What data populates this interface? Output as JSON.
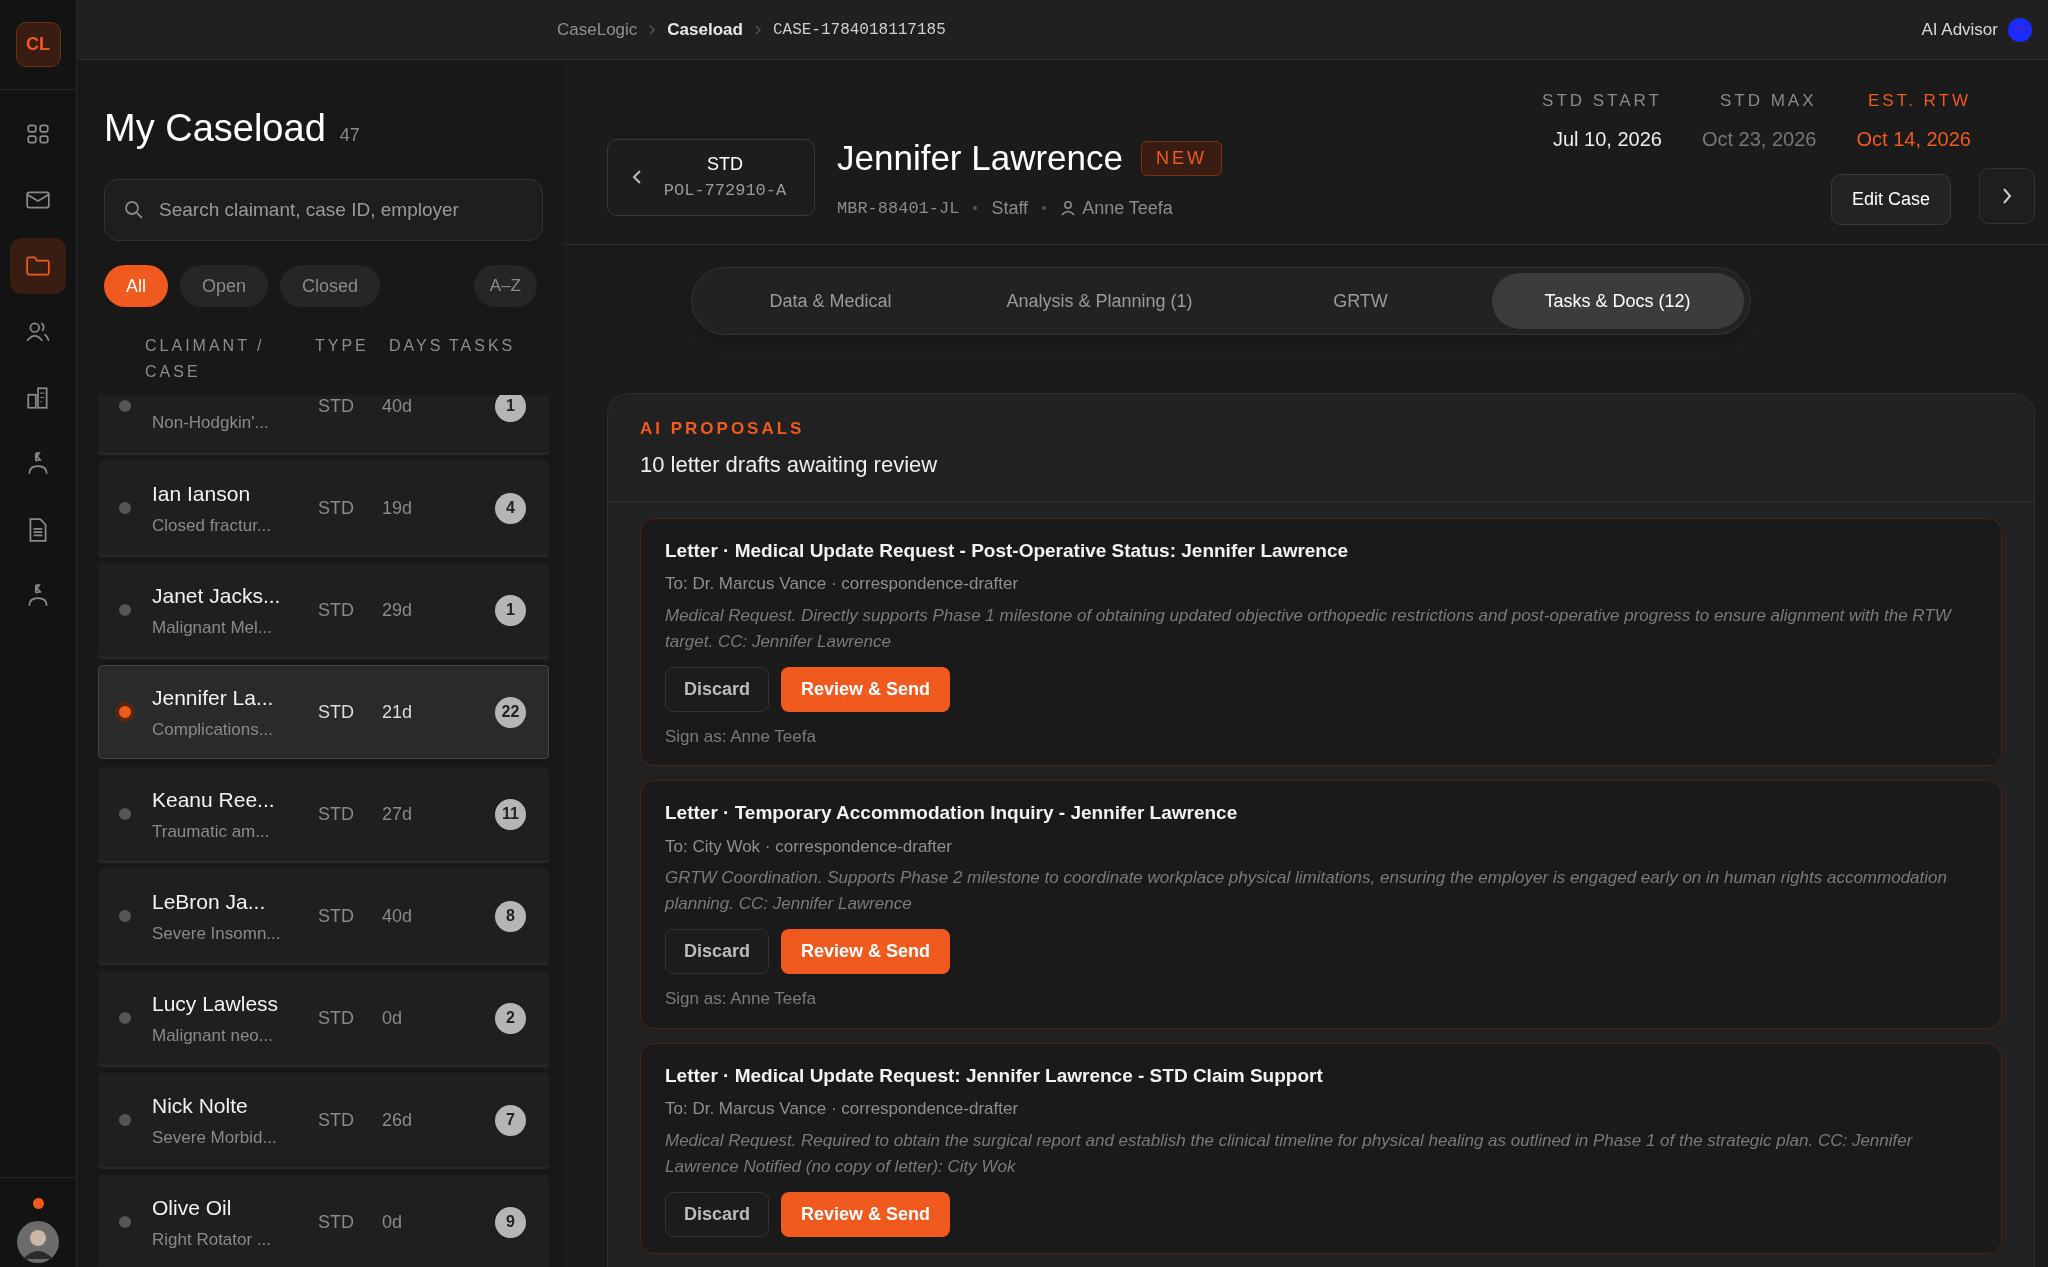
{
  "app": {
    "logo": "CL"
  },
  "nav_items": [
    {
      "selected": false
    },
    {
      "selected": false
    },
    {
      "selected": true
    },
    {
      "selected": false
    },
    {
      "selected": false
    },
    {
      "selected": false
    },
    {
      "selected": false
    },
    {
      "selected": false
    }
  ],
  "breadcrumb": [
    "CaseLogic",
    "Caseload",
    "CASE-1784018117185"
  ],
  "advisor": {
    "label": "AI Advisor"
  },
  "caseload": {
    "title": "My Caseload",
    "count": "47",
    "search": {
      "placeholder": "Search claimant, case ID, employer"
    },
    "filters": [
      {
        "label": "All",
        "selected": true
      },
      {
        "label": "Open",
        "selected": false
      },
      {
        "label": "Closed",
        "selected": false
      }
    ],
    "sort": "A–Z",
    "columns": [
      "CLAIMANT / CASE",
      "TYPE",
      "DAYS",
      "TASKS"
    ],
    "rows": [
      {
        "diagnosis": "Non-Hodgkin'...",
        "type": "STD",
        "days": "40d",
        "tasks": "1",
        "selected": false
      },
      {
        "name": "Ian Ianson",
        "diagnosis": "Closed fractur...",
        "type": "STD",
        "days": "19d",
        "tasks": "4",
        "selected": false
      },
      {
        "name": "Janet Jacks...",
        "diagnosis": "Malignant Mel...",
        "type": "STD",
        "days": "29d",
        "tasks": "1",
        "selected": false
      },
      {
        "name": "Jennifer La...",
        "diagnosis": "Complications...",
        "type": "STD",
        "days": "21d",
        "tasks": "22",
        "selected": true
      },
      {
        "name": "Keanu Ree...",
        "diagnosis": "Traumatic am...",
        "type": "STD",
        "days": "27d",
        "tasks": "11",
        "selected": false
      },
      {
        "name": "LeBron Ja...",
        "diagnosis": "Severe Insomn...",
        "type": "STD",
        "days": "40d",
        "tasks": "8",
        "selected": false
      },
      {
        "name": "Lucy Lawless",
        "diagnosis": "Malignant neo...",
        "type": "STD",
        "days": "0d",
        "tasks": "2",
        "selected": false
      },
      {
        "name": "Nick Nolte",
        "diagnosis": "Severe Morbid...",
        "type": "STD",
        "days": "26d",
        "tasks": "7",
        "selected": false
      },
      {
        "name": "Olive Oil",
        "diagnosis": "Right Rotator ...",
        "type": "STD",
        "days": "0d",
        "tasks": "9",
        "selected": false
      }
    ]
  },
  "case": {
    "plan": "STD",
    "policy": "POL-772910-A",
    "name": "Jennifer Lawrence",
    "badge": "NEW",
    "member_id": "MBR-88401-JL",
    "role": "Staff",
    "manager": "Anne Teefa",
    "dates": [
      {
        "label": "STD START",
        "value": "Jul 10, 2026",
        "kind": "normal"
      },
      {
        "label": "STD MAX",
        "value": "Oct 23, 2026",
        "kind": "muted"
      },
      {
        "label": "EST. RTW",
        "value": "Oct 14, 2026",
        "kind": "accent"
      }
    ],
    "edit_button": "Edit Case"
  },
  "tabs": [
    {
      "label": "Data & Medical",
      "selected": false
    },
    {
      "label": "Analysis & Planning (1)",
      "selected": false
    },
    {
      "label": "GRTW",
      "selected": false
    },
    {
      "label": "Tasks & Docs (12)",
      "selected": true
    }
  ],
  "proposals": {
    "heading": "AI PROPOSALS",
    "title": "10 letter drafts awaiting review",
    "items": [
      {
        "title": "Letter · Medical Update Request - Post-Operative Status: Jennifer Lawrence",
        "to": "To: Dr. Marcus Vance · correspondence-drafter",
        "note": "Medical Request. Directly supports Phase 1 milestone of obtaining updated objective orthopedic restrictions and post-operative progress to ensure alignment with the RTW target. CC: Jennifer Lawrence",
        "discard": "Discard",
        "send": "Review & Send",
        "sign_as": "Sign as: Anne Teefa"
      },
      {
        "title": "Letter · Temporary Accommodation Inquiry - Jennifer Lawrence",
        "to": "To: City Wok · correspondence-drafter",
        "note": "GRTW Coordination. Supports Phase 2 milestone to coordinate workplace physical limitations, ensuring the employer is engaged early on in human rights accommodation planning. CC: Jennifer Lawrence",
        "discard": "Discard",
        "send": "Review & Send",
        "sign_as": "Sign as: Anne Teefa"
      },
      {
        "title": "Letter · Medical Update Request: Jennifer Lawrence - STD Claim Support",
        "to": "To: Dr. Marcus Vance · correspondence-drafter",
        "note": "Medical Request. Required to obtain the surgical report and establish the clinical timeline for physical healing as outlined in Phase 1 of the strategic plan. CC: Jennifer Lawrence Notified (no copy of letter): City Wok",
        "discard": "Discard",
        "send": "Review & Send"
      }
    ]
  }
}
